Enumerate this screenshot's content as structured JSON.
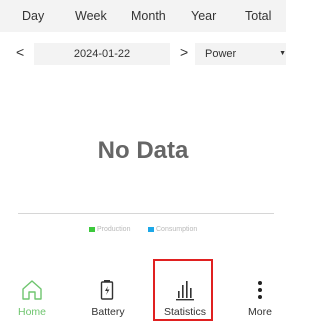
{
  "tabs": [
    "Day",
    "Week",
    "Month",
    "Year",
    "Total"
  ],
  "date_nav": {
    "prev": "<",
    "date": "2024-01-22",
    "next": ">",
    "metric_select": "Power"
  },
  "chart": {
    "empty_text": "No Data",
    "legend": [
      {
        "label": "Production",
        "color": "#3cc93c"
      },
      {
        "label": "Consumption",
        "color": "#1ca8e8"
      }
    ]
  },
  "bottom_nav": {
    "items": [
      {
        "label": "Home",
        "icon": "home-icon",
        "active": true
      },
      {
        "label": "Battery",
        "icon": "battery-icon"
      },
      {
        "label": "Statistics",
        "icon": "bar-chart-icon",
        "highlighted": true
      },
      {
        "label": "More",
        "icon": "more-vertical-icon"
      }
    ],
    "active_color": "#6fc56f",
    "highlight_color": "#e02020"
  }
}
